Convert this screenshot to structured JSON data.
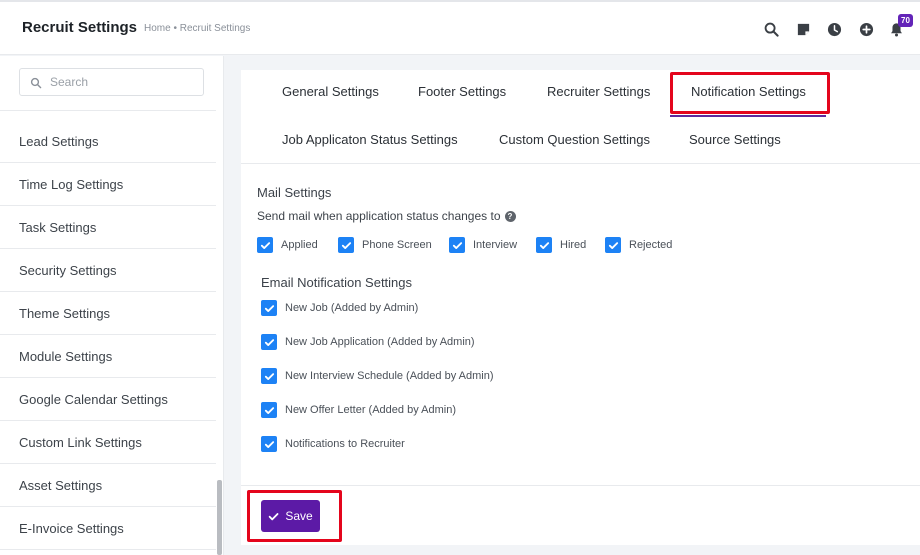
{
  "header": {
    "title": "Recruit Settings",
    "breadcrumb": "Home • Recruit Settings",
    "notification_count": "70"
  },
  "sidebar": {
    "search_placeholder": "Search",
    "items": [
      {
        "label": "Lead Settings"
      },
      {
        "label": "Time Log Settings"
      },
      {
        "label": "Task Settings"
      },
      {
        "label": "Security Settings"
      },
      {
        "label": "Theme Settings"
      },
      {
        "label": "Module Settings"
      },
      {
        "label": "Google Calendar Settings"
      },
      {
        "label": "Custom Link Settings"
      },
      {
        "label": "Asset Settings"
      },
      {
        "label": "E-Invoice Settings"
      }
    ]
  },
  "tabs": {
    "general": "General Settings",
    "footer": "Footer Settings",
    "recruiter": "Recruiter Settings",
    "notification": "Notification Settings",
    "job_status": "Job Applicaton Status Settings",
    "custom_question": "Custom Question Settings",
    "source": "Source Settings",
    "active": "notification"
  },
  "mail": {
    "title": "Mail Settings",
    "description": "Send mail when application status changes to",
    "statuses": [
      {
        "label": "Applied",
        "checked": true
      },
      {
        "label": "Phone Screen",
        "checked": true
      },
      {
        "label": "Interview",
        "checked": true
      },
      {
        "label": "Hired",
        "checked": true
      },
      {
        "label": "Rejected",
        "checked": true
      }
    ]
  },
  "email_notifications": {
    "title": "Email Notification Settings",
    "items": [
      {
        "label": "New Job (Added by Admin)",
        "checked": true
      },
      {
        "label": "New Job Application (Added by Admin)",
        "checked": true
      },
      {
        "label": "New Interview Schedule (Added by Admin)",
        "checked": true
      },
      {
        "label": "New Offer Letter (Added by Admin)",
        "checked": true
      },
      {
        "label": "Notifications to Recruiter",
        "checked": true
      }
    ]
  },
  "actions": {
    "save_label": "Save"
  },
  "colors": {
    "accent": "#5c1aa6",
    "checkbox": "#1d82f5",
    "highlight": "#e4051c",
    "badge": "#6324b8"
  }
}
